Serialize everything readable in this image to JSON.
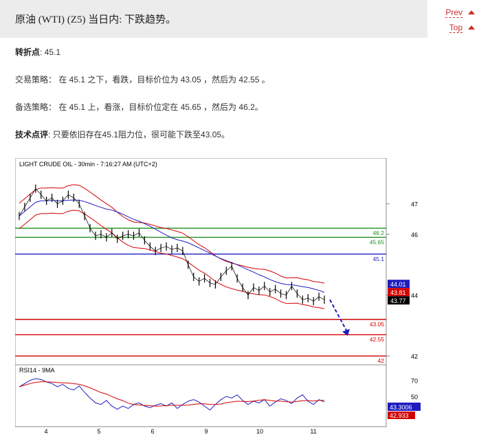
{
  "header": {
    "title": "原油 (WTI) (Z5) 当日内: 下跌趋势。",
    "prev_label": "Prev",
    "top_label": "Top"
  },
  "analysis": {
    "pivot_label": "转折点",
    "pivot_value": ": 45.1",
    "strategy": "交易策略： 在 45.1 之下，看跌，目标价位为 43.05 ，然后为 42.55 。",
    "alternative": "备选策略： 在 45.1 上，看涨，目标价位定在 45.65 ，然后为 46.2。",
    "comment_label": "技术点评",
    "comment_text": ": 只要依旧存在45.1阻力位，很可能下跌至43.05。"
  },
  "chart_data": {
    "type": "line",
    "title": "LIGHT CRUDE OIL - 30min - 7:16:27 AM (UTC+2)",
    "x_labels": [
      "4",
      "5",
      "6",
      "9",
      "10",
      "11"
    ],
    "y_ticks": [
      "47",
      "46",
      "44",
      "42"
    ],
    "ylim": [
      41.8,
      48.1
    ],
    "levels": [
      {
        "label": "46.2",
        "value": 46.2,
        "color": "#1f8f1f"
      },
      {
        "label": "45.65",
        "value": 45.9,
        "color": "#1f8f1f"
      },
      {
        "label": "45.1",
        "value": 45.35,
        "color": "#1d1dbf"
      },
      {
        "label": "43.05",
        "value": 43.2,
        "color": "#d20000"
      },
      {
        "label": "42.55",
        "value": 42.7,
        "color": "#d20000"
      },
      {
        "label": "42",
        "value": 42.0,
        "color": "#d20000"
      }
    ],
    "price_tags": [
      {
        "label": "44.01",
        "color": "#1d1dbf"
      },
      {
        "label": "43.81",
        "color": "#d20000"
      },
      {
        "label": "43.77",
        "color": "#000000"
      }
    ],
    "price": [
      46.6,
      46.9,
      47.2,
      47.5,
      47.3,
      47.1,
      47.2,
      47.0,
      47.1,
      47.3,
      47.2,
      47.0,
      46.6,
      46.2,
      45.95,
      46.0,
      45.9,
      46.05,
      45.85,
      45.95,
      46.0,
      45.95,
      46.05,
      45.8,
      45.6,
      45.45,
      45.55,
      45.6,
      45.5,
      45.55,
      45.45,
      45.0,
      44.6,
      44.45,
      44.55,
      44.4,
      44.35,
      44.6,
      44.8,
      44.95,
      44.55,
      44.25,
      44.0,
      44.25,
      44.15,
      44.3,
      44.1,
      44.2,
      44.05,
      44.0,
      44.3,
      44.05,
      43.85,
      43.9,
      43.8,
      43.95,
      43.85
    ],
    "rsi": {
      "title": "RSI14 - 9MA",
      "y_ticks": [
        "70",
        "50"
      ],
      "ylim": [
        15,
        85
      ],
      "current_rsi": "43.3006",
      "current_ma": "42.933",
      "values": [
        62,
        66,
        70,
        72,
        71,
        68,
        66,
        62,
        65,
        60,
        58,
        63,
        55,
        48,
        42,
        40,
        45,
        38,
        34,
        38,
        35,
        40,
        42,
        38,
        36,
        39,
        41,
        38,
        42,
        35,
        40,
        44,
        46,
        43,
        38,
        33,
        40,
        46,
        50,
        48,
        52,
        45,
        40,
        44,
        42,
        46,
        38,
        43,
        47,
        45,
        41,
        48,
        52,
        44,
        40,
        46,
        43
      ]
    }
  }
}
